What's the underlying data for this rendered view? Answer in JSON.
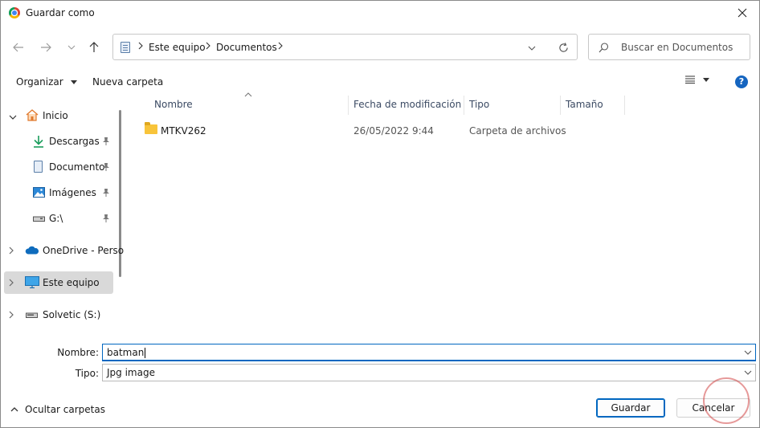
{
  "window": {
    "title": "Guardar como"
  },
  "address": {
    "crumbs": [
      "Este equipo",
      "Documentos"
    ]
  },
  "search": {
    "placeholder": "Buscar en Documentos"
  },
  "toolbar": {
    "organize_label": "Organizar",
    "new_folder_label": "Nueva carpeta"
  },
  "sidebar": {
    "items": [
      {
        "label": "Inicio"
      },
      {
        "label": "Descargas"
      },
      {
        "label": "Documento"
      },
      {
        "label": "Imágenes"
      },
      {
        "label": "G:\\"
      },
      {
        "label": "OneDrive - Perso"
      },
      {
        "label": "Este equipo"
      },
      {
        "label": "Solvetic (S:)"
      }
    ],
    "selected": "Este equipo"
  },
  "columns": [
    "Nombre",
    "Fecha de modificación",
    "Tipo",
    "Tamaño"
  ],
  "files": [
    {
      "name": "MTKV262",
      "modified": "26/05/2022 9:44",
      "type": "Carpeta de archivos",
      "size": ""
    }
  ],
  "form": {
    "name_label": "Nombre:",
    "name_value": "batman",
    "type_label": "Tipo:",
    "type_value": "Jpg image"
  },
  "footer": {
    "hide_folders_label": "Ocultar carpetas",
    "save_label": "Guardar",
    "cancel_label": "Cancelar"
  },
  "colors": {
    "accent": "#0067c0",
    "help": "#1565c0",
    "folder": "#f8c43a",
    "selected_bg": "#d9d9d9"
  },
  "icons": [
    "chrome-icon",
    "close-icon",
    "back-arrow-icon",
    "forward-arrow-icon",
    "up-arrow-icon",
    "document-icon",
    "chevron-right-icon",
    "chevron-down-icon",
    "refresh-icon",
    "search-icon",
    "view-list-icon",
    "help-icon",
    "home-icon",
    "download-icon",
    "image-icon",
    "drive-icon",
    "onedrive-icon",
    "computer-icon",
    "pin-icon",
    "folder-icon",
    "chevron-up-icon"
  ]
}
